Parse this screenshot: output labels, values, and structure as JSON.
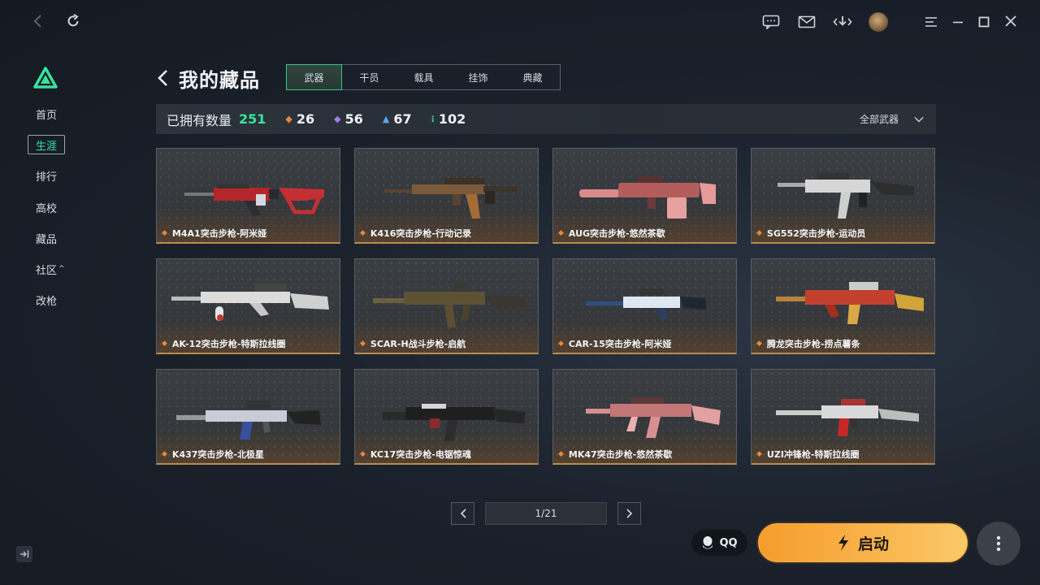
{
  "sidebar": {
    "items": [
      {
        "label": "首页"
      },
      {
        "label": "生涯"
      },
      {
        "label": "排行"
      },
      {
        "label": "高校"
      },
      {
        "label": "藏品"
      },
      {
        "label": "社区"
      },
      {
        "label": "改枪"
      }
    ]
  },
  "header": {
    "title": "我的藏品",
    "tabs": [
      "武器",
      "干员",
      "载具",
      "挂饰",
      "典藏"
    ]
  },
  "stats": {
    "owned_label": "已拥有数量",
    "owned_count": "251",
    "rarity": [
      {
        "count": "26",
        "color": "#e8873a"
      },
      {
        "count": "56",
        "color": "#a07ef0"
      },
      {
        "count": "67",
        "color": "#5aa8f0"
      },
      {
        "count": "102",
        "color": "#3ed6a0"
      }
    ],
    "filter_label": "全部武器"
  },
  "items": [
    {
      "name": "M4A1突击步枪-阿米娅"
    },
    {
      "name": "K416突击步枪-行动记录"
    },
    {
      "name": "AUG突击步枪-悠然茶歇"
    },
    {
      "name": "SG552突击步枪-运动员"
    },
    {
      "name": "AK-12突击步枪-特斯拉线圈"
    },
    {
      "name": "SCAR-H战斗步枪-启航"
    },
    {
      "name": "CAR-15突击步枪-阿米娅"
    },
    {
      "name": "腾龙突击步枪-捞点薯条"
    },
    {
      "name": "K437突击步枪-北极星"
    },
    {
      "name": "KC17突击步枪-电锯惊魂"
    },
    {
      "name": "MK47突击步枪-悠然茶歇"
    },
    {
      "name": "UZI冲锋枪-特斯拉线圈"
    }
  ],
  "pagination": {
    "label": "1/21"
  },
  "footer": {
    "qq_label": "QQ",
    "launch_label": "启动"
  },
  "icons": {
    "topbar": [
      "back-icon",
      "refresh-icon",
      "chat-icon",
      "mail-icon",
      "download-icon",
      "avatar",
      "menu-icon",
      "minimize-icon",
      "maximize-icon",
      "close-icon"
    ]
  },
  "colors": {
    "accent": "#33e3a0",
    "launch": "#f7a83a",
    "card_border_bottom": "#b98a50"
  }
}
